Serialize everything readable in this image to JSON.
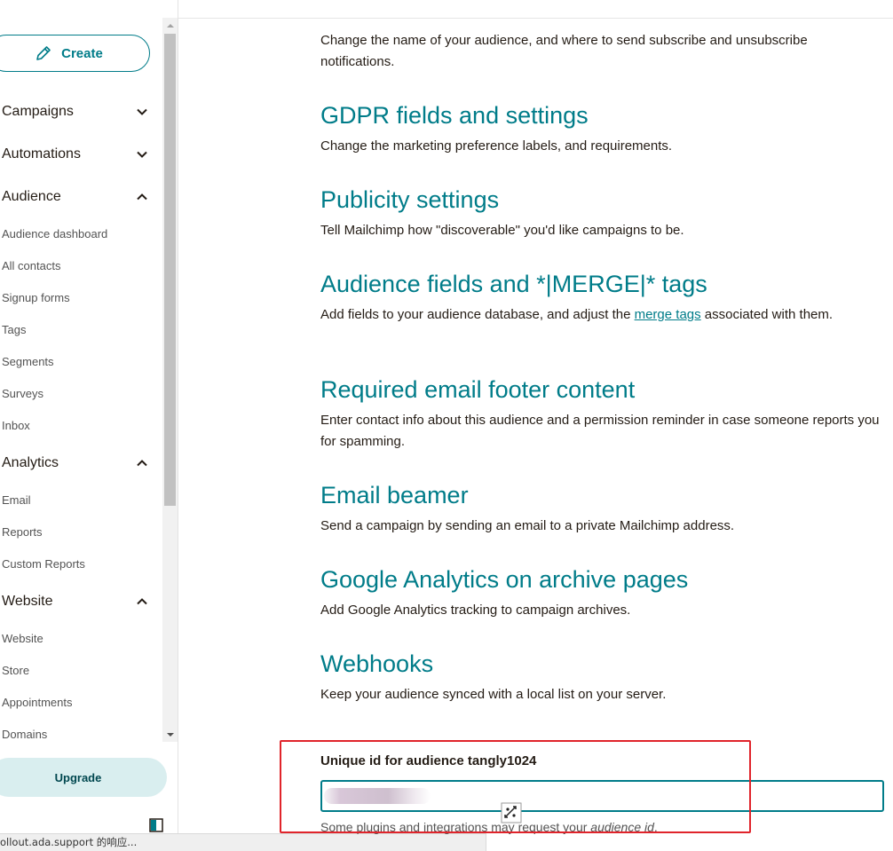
{
  "sidebar": {
    "create_label": "Create",
    "sections": {
      "campaigns": "Campaigns",
      "automations": "Automations",
      "audience": "Audience",
      "analytics": "Analytics",
      "website": "Website"
    },
    "audience_items": [
      "Audience dashboard",
      "All contacts",
      "Signup forms",
      "Tags",
      "Segments",
      "Surveys",
      "Inbox"
    ],
    "analytics_items": [
      "Email",
      "Reports",
      "Custom Reports"
    ],
    "website_items": [
      "Website",
      "Store",
      "Appointments",
      "Domains"
    ],
    "upgrade_label": "Upgrade"
  },
  "status_bar": {
    "text": "ollout.ada.support 的响应..."
  },
  "settings": {
    "intro_desc": "Change the name of your audience, and where to send subscribe and unsubscribe notifications.",
    "gdpr": {
      "title": "GDPR fields and settings",
      "desc": "Change the marketing preference labels, and requirements."
    },
    "publicity": {
      "title": "Publicity settings",
      "desc": "Tell Mailchimp how \"discoverable\" you'd like campaigns to be."
    },
    "fields": {
      "title": "Audience fields and *|MERGE|* tags",
      "desc_before": "Add fields to your audience database, and adjust the ",
      "link": "merge tags",
      "desc_after": " associated with them."
    },
    "footer": {
      "title": "Required email footer content",
      "desc": "Enter contact info about this audience and a permission reminder in case someone reports you for spamming."
    },
    "beamer": {
      "title": "Email beamer",
      "desc": "Send a campaign by sending an email to a private Mailchimp address."
    },
    "google": {
      "title": "Google Analytics on archive pages",
      "desc": "Add Google Analytics tracking to campaign archives."
    },
    "webhooks": {
      "title": "Webhooks",
      "desc": "Keep your audience synced with a local list on your server."
    }
  },
  "unique_id": {
    "label": "Unique id for audience tangly1024",
    "value": "",
    "help_before": "Some plugins and integrations may request your ",
    "help_em": "audience id",
    "help_after": "."
  },
  "icons": {
    "create": "pencil-icon",
    "collapsed": "chevron-down-icon",
    "expanded": "chevron-up-icon",
    "sidebar_toggle": "sidebar-collapse-icon"
  },
  "colors": {
    "accent": "#007c89",
    "highlight": "#e0242b",
    "upgrade_bg": "#d9eeef"
  }
}
